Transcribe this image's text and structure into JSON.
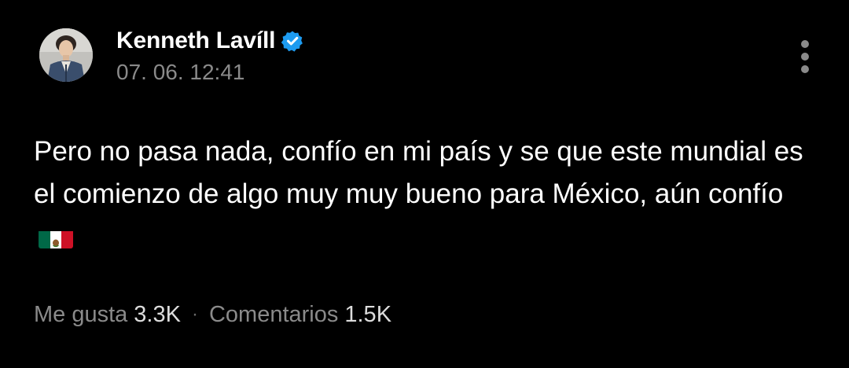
{
  "post": {
    "author": {
      "name": "Kenneth Lavíll",
      "verified": true,
      "avatar_icon": "profile-photo",
      "verified_color": "#1d9bf0"
    },
    "timestamp": "07. 06. 12:41",
    "body": "Pero no pasa nada, confío en mi país y se que este mundial es el comienzo de algo muy muy bueno para México, aún confío",
    "emoji": "mexico-flag",
    "stats": {
      "likes_label": "Me gusta",
      "likes_value": "3.3K",
      "separator": "·",
      "comments_label": "Comentarios",
      "comments_value": "1.5K"
    },
    "menu_icon": "more-vertical-icon"
  },
  "colors": {
    "background": "#000000",
    "text_primary": "#ffffff",
    "text_secondary": "#8a8a8a"
  }
}
